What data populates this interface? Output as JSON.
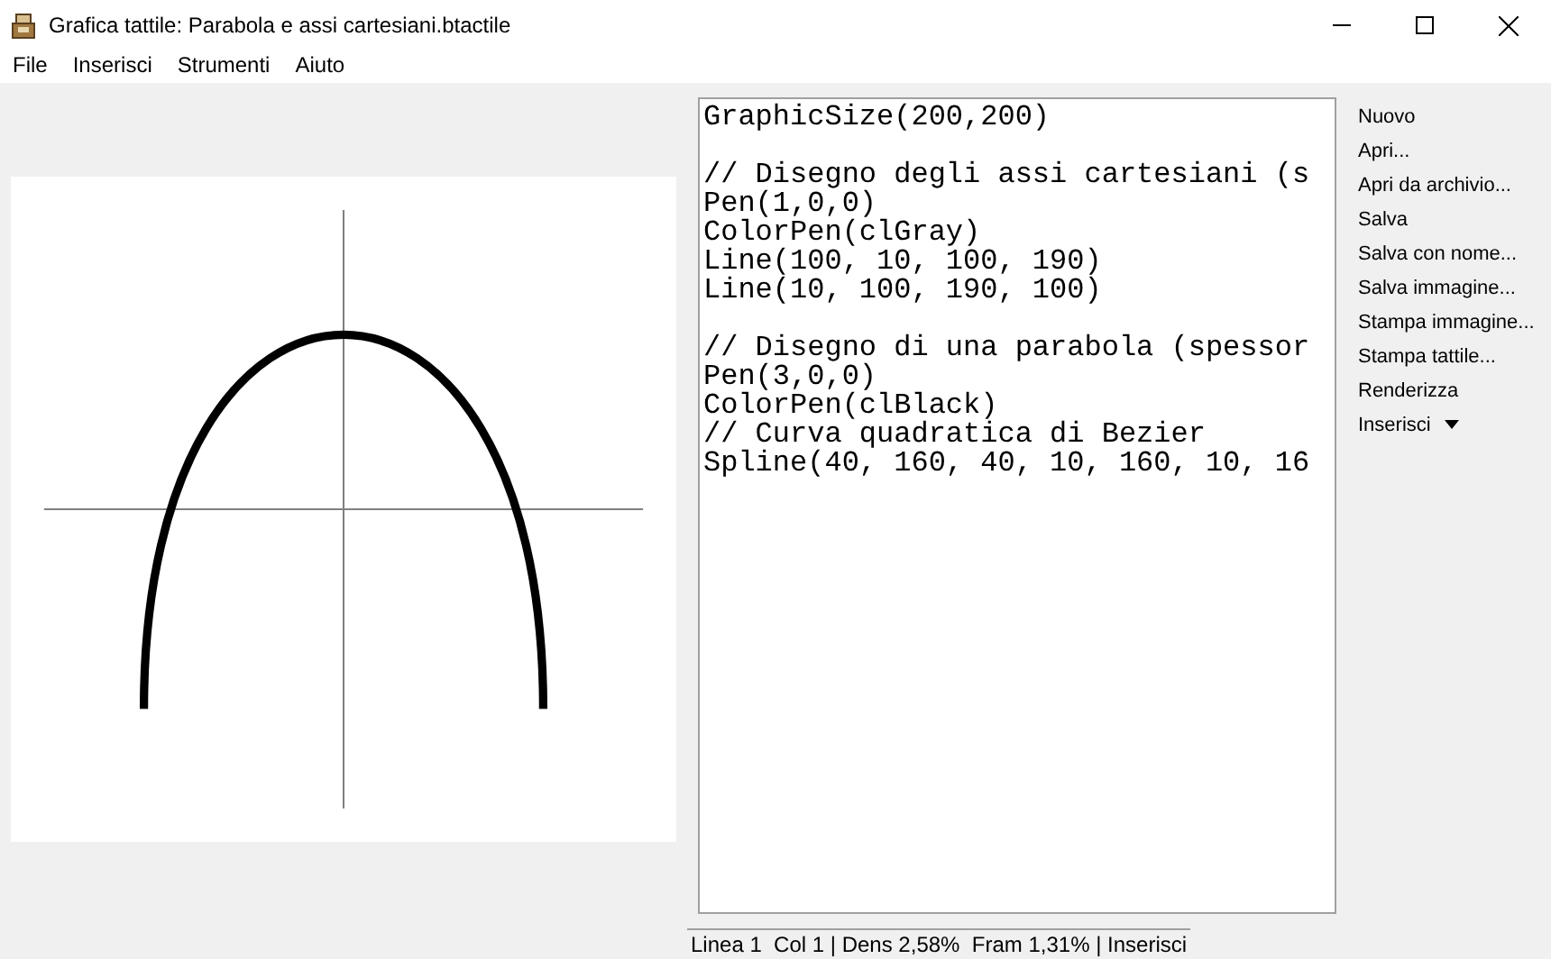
{
  "window": {
    "title": "Grafica tattile: Parabola e assi cartesiani.btactile"
  },
  "menu": [
    "File",
    "Inserisci",
    "Strumenti",
    "Aiuto"
  ],
  "editor": {
    "blocks": [
      [
        "GraphicSize(200,200)"
      ],
      [
        "// Disegno degli assi cartesiani (s",
        "Pen(1,0,0)",
        "ColorPen(clGray)",
        "Line(100, 10, 100, 190)",
        "Line(10, 100, 190, 100)"
      ],
      [
        "// Disegno di una parabola (spessor",
        "Pen(3,0,0)",
        "ColorPen(clBlack)",
        "// Curva quadratica di Bezier",
        "Spline(40, 160, 40, 10, 160, 10, 16"
      ]
    ]
  },
  "buttons": [
    {
      "label": "Nuovo",
      "kind": "plain"
    },
    {
      "label": "Apri...",
      "kind": "plain"
    },
    {
      "label": "Apri da archivio...",
      "kind": "plain"
    },
    {
      "label": "Salva",
      "kind": "plain"
    },
    {
      "label": "Salva con nome...",
      "kind": "plain"
    },
    {
      "label": "Salva immagine...",
      "kind": "plain"
    },
    {
      "label": "Stampa immagine...",
      "kind": "plain"
    },
    {
      "label": "Stampa tattile...",
      "kind": "plain"
    },
    {
      "label": "Renderizza",
      "kind": "plain"
    },
    {
      "label": "Inserisci",
      "kind": "dropdown"
    }
  ],
  "status_bar": "Linea 1  Col 1 | Dens 2,58%  Fram 1,31% | Inserisci"
}
